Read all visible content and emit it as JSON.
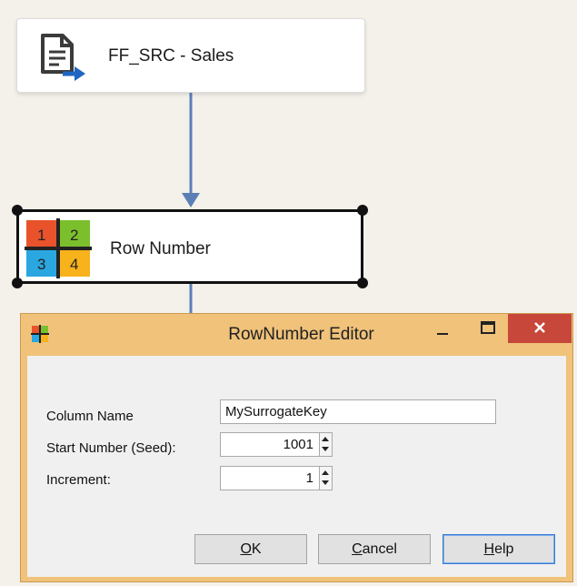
{
  "canvas": {
    "source_component": {
      "label": "FF_SRC - Sales",
      "icon": "flat-file-source-icon"
    },
    "row_component": {
      "label": "Row Number",
      "icon": "row-number-icon",
      "icon_digits": [
        "1",
        "2",
        "3",
        "4"
      ]
    }
  },
  "dialog": {
    "title": "RowNumber Editor",
    "title_icon": "row-number-icon",
    "buttons": {
      "minimize": "–",
      "maximize": "□",
      "close": "✕"
    },
    "fields": {
      "column_name": {
        "label": "Column Name",
        "value": "MySurrogateKey"
      },
      "start_number": {
        "label": "Start Number (Seed):",
        "value": "1001"
      },
      "increment": {
        "label": "Increment:",
        "value": "1"
      }
    },
    "actions": {
      "ok": {
        "accel": "O",
        "rest": "K"
      },
      "cancel": {
        "accel": "C",
        "rest": "ancel"
      },
      "help": {
        "accel": "H",
        "rest": "elp"
      }
    }
  },
  "colors": {
    "dialog_frame": "#f0c27a",
    "close_button": "#c7473a",
    "connector": "#5b7fb5",
    "tile_red": "#e8532b",
    "tile_green": "#7cbf2d",
    "tile_blue": "#2aa7e1",
    "tile_yellow": "#f7b21c"
  }
}
